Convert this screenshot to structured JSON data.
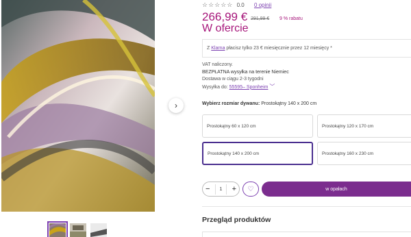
{
  "colors": {
    "accent": "#a6157a",
    "purple": "#7b2d8e",
    "selected_border": "#4a2e8f"
  },
  "gallery": {
    "next_icon": "chevron-right-icon",
    "next_glyph": "›",
    "thumbnails": [
      "rug-pattern-thumb",
      "rug-room-thumb",
      "rug-side-thumb"
    ]
  },
  "rating": {
    "stars": "☆☆☆☆☆",
    "score": "0.0",
    "opinions": "0 opinii"
  },
  "price": {
    "current": "266,99 €",
    "old": "291,99 €",
    "discount": "9 % rabatu",
    "status": "W ofercie"
  },
  "klarna": {
    "prefix": "Z",
    "link": "Klarna",
    "text": "płacisz tylko 23 € miesięcznie przez 12 miesięcy *"
  },
  "info": {
    "vat": "VAT naliczony.",
    "shipping": "BEZPŁATNA wysyłka na terenie Niemiec",
    "delivery": "Dostawa w ciągu 2-3 tygodni",
    "ship_from_label": "Wysyłka do:",
    "ship_from_link": "55595– Sponheim",
    "chevron": "﹀"
  },
  "size": {
    "label": "Wybierz rozmiar dywanu:",
    "selected_value": "Prostokątny 140 x 200 cm",
    "options": [
      "Prostokątny 60 x 120 cm",
      "Prostokątny 120 x 170 cm",
      "Prostokątny 140 x 200 cm",
      "Prostokątny 160 x 230 cm"
    ]
  },
  "quantity": {
    "minus": "−",
    "value": "1",
    "plus": "+"
  },
  "wishlist_glyph": "♡",
  "cart_label": "w opałach",
  "reviews_title": "Przegląd produktów"
}
